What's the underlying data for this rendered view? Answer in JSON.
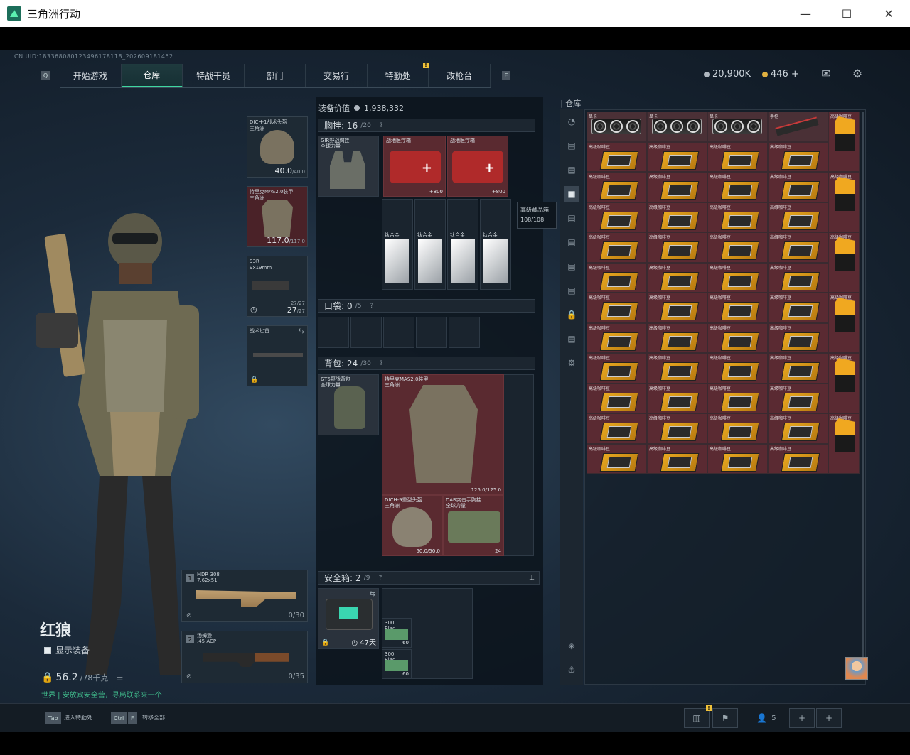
{
  "window": {
    "title": "三角洲行动",
    "min": "—",
    "max": "☐",
    "close": "✕"
  },
  "uid": "CN UID:1833680801234961781​18_202609181452",
  "nav": {
    "left_key": "Q",
    "right_key": "E",
    "tabs": [
      "开始游戏",
      "仓库",
      "特战干员",
      "部门",
      "交易行",
      "特勤处",
      "改枪台"
    ],
    "active": "仓库",
    "badge": "!"
  },
  "currency": {
    "silver": "20,900K",
    "gold": "446",
    "plus": "+"
  },
  "player": {
    "name": "红狼",
    "show_gear": "显示装备",
    "weight": "56.2",
    "weight_max": "/78千克",
    "chat": "世界 | 安放宾安全营，寻局联系来一个"
  },
  "equip": {
    "helmet": {
      "label": "DICH-1战术头盔\n三角洲",
      "value": "40.0",
      "max": "/40.0"
    },
    "armor": {
      "label": "特里克MAS2.0装甲\n三角洲",
      "value": "117.0",
      "max": "/117.0"
    },
    "pistol": {
      "label": "93R\n9x19mm",
      "ammo_top": "27/27",
      "ammo": "27",
      "ammo_max": "/27"
    },
    "melee": {
      "label": "战术匕首"
    }
  },
  "weapons": [
    {
      "num": "1",
      "label": "MDR 308\n7.62x51",
      "ammo": "0/30"
    },
    {
      "num": "2",
      "label": "汤姆逊\n.45 ACP",
      "ammo": "0/35"
    }
  ],
  "center": {
    "value_label": "装备价值",
    "value": "1,938,332",
    "chest": {
      "title": "胸挂:",
      "count": "16",
      "cap": "/20",
      "q": "?"
    },
    "chest_items": [
      {
        "label": "GIR野战胸挂\n全球力量"
      },
      {
        "label": "战地医疗箱",
        "val": "+800"
      },
      {
        "label": "战地医疗箱",
        "val": "+800"
      }
    ],
    "plates": [
      "钛合金",
      "钛合金",
      "钛合金",
      "钛合金"
    ],
    "pocket": {
      "title": "口袋:",
      "count": "0",
      "cap": "/5",
      "q": "?"
    },
    "backpack": {
      "title": "背包:",
      "count": "24",
      "cap": "/30",
      "q": "?"
    },
    "bp_items": [
      {
        "label": "GT5野战背包\n全球力量"
      },
      {
        "label": "特里克MAS2.0装甲\n三角洲",
        "val": "125.0/125.0"
      },
      {
        "label": "DICH-9重型头盔\n三角洲",
        "val": "50.0/50.0"
      },
      {
        "label": "DAR突击手胸挂\n全球力量",
        "val": "24"
      }
    ],
    "safe": {
      "title": "安全箱:",
      "count": "2",
      "cap": "/9",
      "q": "?",
      "days": "47天",
      "pin": "📌"
    },
    "safe_items": [
      {
        "label": "300 Blac...",
        "val": "60"
      },
      {
        "label": "300 Blac...",
        "val": "60"
      }
    ]
  },
  "tooltip": {
    "title": "高级藏品箱",
    "value": "108/108"
  },
  "stash": {
    "label": "仓库",
    "gpu_label": "显卡",
    "handgun_label": "手枪",
    "crate_label": "高级咖啡豆",
    "bag_label": "高级咖啡豆"
  },
  "bottom": {
    "tab_key": "Tab",
    "tab_hint": "进入特勤处",
    "ctrl_key": "Ctrl",
    "f_key": "F",
    "f_hint": "转移全部",
    "friends": "5",
    "badge": "!"
  },
  "colors": {
    "accent": "#3fd6a0",
    "red_item": "#5a2a32",
    "badge": "#f0c23a"
  }
}
